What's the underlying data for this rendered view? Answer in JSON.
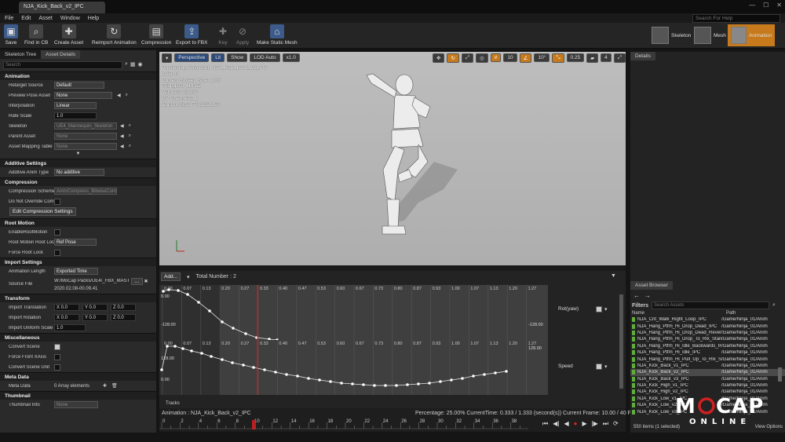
{
  "window": {
    "tab_title": "NJA_Kick_Back_v2_IPC"
  },
  "menu": [
    "File",
    "Edit",
    "Asset",
    "Window",
    "Help"
  ],
  "help_search_placeholder": "Search For Help",
  "toolbar": [
    {
      "label": "Save",
      "icon": "save-icon"
    },
    {
      "label": "Find in CB",
      "icon": "find-in-cb-icon"
    },
    {
      "label": "Create Asset",
      "icon": "create-asset-icon"
    },
    {
      "label": "Reimport Animation",
      "icon": "reimport-icon"
    },
    {
      "label": "Compression",
      "icon": "compression-icon"
    },
    {
      "label": "Export to FBX",
      "icon": "export-icon"
    },
    {
      "label": "Key",
      "icon": "key-icon"
    },
    {
      "label": "Apply",
      "icon": "apply-icon"
    },
    {
      "label": "Make Static Mesh",
      "icon": "static-mesh-icon"
    }
  ],
  "modes": [
    {
      "label": "Skeleton"
    },
    {
      "label": "Mesh"
    },
    {
      "label": "Animation"
    }
  ],
  "left_panel": {
    "tabs": [
      "Skeleton Tree",
      "Asset Details"
    ],
    "search_placeholder": "Search",
    "sections": {
      "animation": {
        "title": "Animation",
        "retarget_source": {
          "label": "Retarget Source",
          "value": "Default"
        },
        "preview_pose": {
          "label": "Preview Pose Asset",
          "value": "None"
        },
        "interpolation": {
          "label": "Interpolation",
          "value": "Linear"
        },
        "rate_scale": {
          "label": "Rate Scale",
          "value": "1.0"
        },
        "skeleton": {
          "label": "Skeleton",
          "value": "UE4_Mannequin_Skeleton"
        },
        "parent_asset": {
          "label": "Parent Asset",
          "value": "None"
        },
        "asset_mapping": {
          "label": "Asset Mapping Table",
          "value": "None"
        }
      },
      "additive": {
        "title": "Additive Settings",
        "type": {
          "label": "Additive Anim Type",
          "value": "No additive"
        }
      },
      "compression": {
        "title": "Compression",
        "scheme": {
          "label": "Compression Scheme",
          "value": "AnimCompress_BitwiseCom"
        },
        "no_override": {
          "label": "Do Not Override Com"
        },
        "edit_button": "Edit Compression Settings"
      },
      "root_motion": {
        "title": "Root Motion",
        "enable": {
          "label": "EnableRootMotion"
        },
        "root_lock": {
          "label": "Root Motion Root Loc",
          "value": "Ref Pose"
        },
        "force_root": {
          "label": "Force Root Lock"
        }
      },
      "import": {
        "title": "Import Settings",
        "anim_length": {
          "label": "Animation Length",
          "value": "Exported Time"
        },
        "source_file": {
          "label": "Source File",
          "value": "W:/MoCap Packs/UE4/_FBX_MASTE",
          "date": "2020.02.08-00.09.41"
        }
      },
      "transform": {
        "title": "Transform",
        "translation": {
          "label": "Import Translation",
          "x": "X  0.0",
          "y": "Y  0.0",
          "z": "Z  0.0"
        },
        "rotation": {
          "label": "Import Rotation",
          "x": "X  0.0",
          "y": "Y  0.0",
          "z": "Z  0.0"
        },
        "scale": {
          "label": "Import Uniform Scale",
          "value": "1.0"
        }
      },
      "misc": {
        "title": "Miscellaneous",
        "convert_scene": {
          "label": "Convert Scene"
        },
        "force_front": {
          "label": "Force Front XAxis"
        },
        "convert_unit": {
          "label": "Convert Scene Unit"
        }
      },
      "meta": {
        "title": "Meta Data",
        "label": "Meta Data",
        "value": "0 Array elements"
      },
      "thumbnail": {
        "title": "Thumbnail",
        "label": "Thumbnail Info",
        "value": "None"
      }
    }
  },
  "viewport": {
    "perspective": "Perspective",
    "lit": "Lit",
    "show": "Show",
    "lod": "LOD Auto",
    "speed": "x1.0",
    "grid_snap": "10",
    "rot_snap": "10°",
    "scale_snap": "0.25",
    "cam_speed": "4",
    "preview_line": "Previewing Animation NJA_Kick_Back_v2_IPC",
    "stats": [
      "LOD: 0",
      "Current Screen Size: 1.05",
      "Triangles: 41,052",
      "Vertices: 23,237",
      "UV Channels: 1",
      "Approx Size: 77x125x155"
    ]
  },
  "curves": {
    "add_button": "Add...",
    "total": "Total Number : 2",
    "ticks": [
      "0.00",
      "0.07",
      "0.13",
      "0.20",
      "0.27",
      "0.33",
      "0.40",
      "0.47",
      "0.53",
      "0.60",
      "0.67",
      "0.73",
      "0.80",
      "0.87",
      "0.93",
      "1.00",
      "1.07",
      "1.13",
      "1.20",
      "1.27"
    ],
    "rot": {
      "name": "Rot(yaw)",
      "max": "0.00",
      "min": "-128.00",
      "right_min": "-128.00"
    },
    "speed": {
      "name": "Speed",
      "max": "128.00",
      "min": "0.00",
      "right_max": "128.00"
    },
    "tracks": "Tracks"
  },
  "anim_bar": {
    "name": "Animation : NJA_Kick_Back_v2_IPC",
    "percentage": "Percentage: 25.00% CurrentTime: 0.333 / 1.333 (second(s)) Current Frame: 10.00 / 40 Frame",
    "frames": [
      "0",
      "2",
      "4",
      "6",
      "8",
      "10",
      "12",
      "14",
      "16",
      "18",
      "20",
      "22",
      "24",
      "26",
      "28",
      "30",
      "32",
      "34",
      "36",
      "38"
    ],
    "frames_current": 10,
    "frames_total": 40
  },
  "details": {
    "tab": "Details"
  },
  "asset_browser": {
    "tab": "Asset Browser",
    "filters": "Filters",
    "search_placeholder": "Search Assets",
    "col_name": "Name",
    "col_path": "Path",
    "items": [
      {
        "name": "NJA_Crit_Walk_Right_Loop_IPC",
        "path": "/Game/Ninja_01/Anim"
      },
      {
        "name": "NJA_Hang_Ptfm_Hi_Drop_Dead_IPC",
        "path": "/Game/Ninja_01/Anim"
      },
      {
        "name": "NJA_Hang_Ptfm_Hi_Drop_Dead_Reverse",
        "path": "/Game/Ninja_01/Anim"
      },
      {
        "name": "NJA_Hang_Ptfm_Hi_Drop_To_Rlx_Stan",
        "path": "/Game/Ninja_01/Anim"
      },
      {
        "name": "NJA_Hang_Ptfm_Hi_Idle_Backwards_IF",
        "path": "/Game/Ninja_01/Anim"
      },
      {
        "name": "NJA_Hang_Ptfm_Hi_Idle_IPC",
        "path": "/Game/Ninja_01/Anim"
      },
      {
        "name": "NJA_Hang_Ptfm_Hi_Pull_Up_To_Rlx_St",
        "path": "/Game/Ninja_01/Anim"
      },
      {
        "name": "NJA_Kick_Back_v1_IPC",
        "path": "/Game/Ninja_01/Anim"
      },
      {
        "name": "NJA_Kick_Back_v2_IPC",
        "path": "/Game/Ninja_01/Anim"
      },
      {
        "name": "NJA_Kick_Back_v3_IPC",
        "path": "/Game/Ninja_01/Anim"
      },
      {
        "name": "NJA_Kick_High_v1_IPC",
        "path": "/Game/Ninja_01/Anim"
      },
      {
        "name": "NJA_Kick_High_v2_IPC",
        "path": "/Game/Ninja_01/Anim"
      },
      {
        "name": "NJA_Kick_Low_v1_IPC",
        "path": "/Game/Ninja_01/Anim"
      },
      {
        "name": "NJA_Kick_Low_v2_IPC",
        "path": "/Game/Ninja_01/Anim"
      },
      {
        "name": "NJA_Kick_Low_v3_IPC",
        "path": "/Game/Ninja_01/Anim"
      }
    ],
    "count": "550 items (1 selected)",
    "view_options": "View Options"
  },
  "logo": {
    "text_top": "MOCAP",
    "text_bottom": "ONLINE"
  },
  "colors": {
    "accent": "#c77a1b",
    "playhead": "#d22020",
    "key_green": "#5fae3c"
  }
}
